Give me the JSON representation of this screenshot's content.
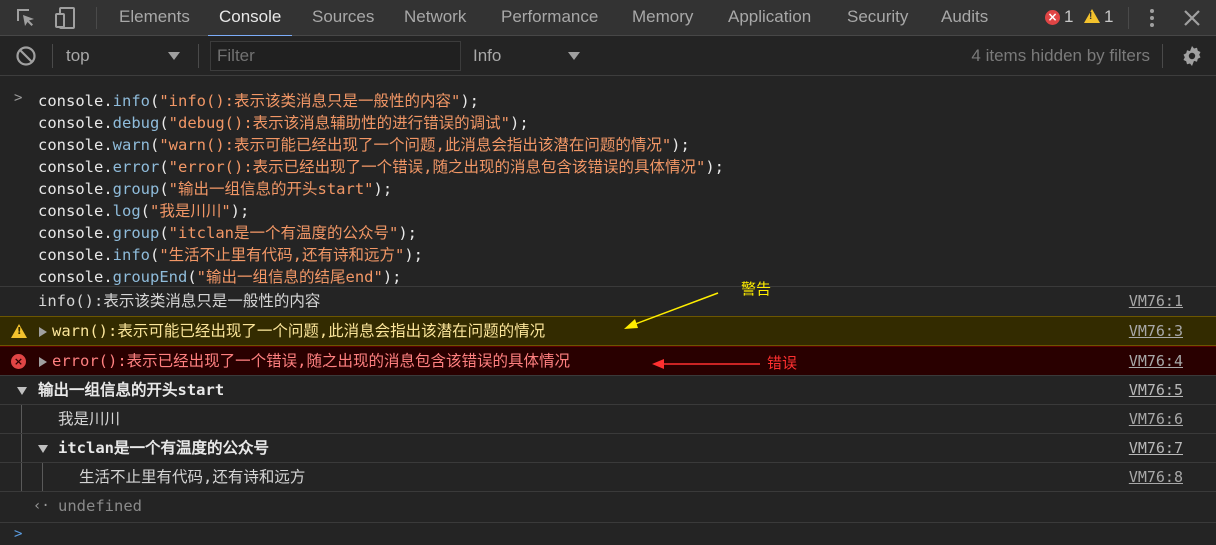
{
  "toolbar": {
    "tabs": [
      "Elements",
      "Console",
      "Sources",
      "Network",
      "Performance",
      "Memory",
      "Application",
      "Security",
      "Audits"
    ],
    "active_tab": "Console",
    "error_count": "1",
    "warning_count": "1"
  },
  "filter_bar": {
    "context": "top",
    "filter_placeholder": "Filter",
    "level": "Info",
    "hidden_text": "4 items hidden by filters"
  },
  "command_lines": [
    {
      "obj": "console.",
      "fn": "info",
      "arg": "\"info():表示该类消息只是一般性的内容\"",
      "end": ");"
    },
    {
      "obj": "console.",
      "fn": "debug",
      "arg": "\"debug():表示该消息辅助性的进行错误的调试\"",
      "end": ");"
    },
    {
      "obj": "console.",
      "fn": "warn",
      "arg": "\"warn():表示可能已经出现了一个问题,此消息会指出该潜在问题的情况\"",
      "end": ");"
    },
    {
      "obj": "console.",
      "fn": "error",
      "arg": "\"error():表示已经出现了一个错误,随之出现的消息包含该错误的具体情况\"",
      "end": ");"
    },
    {
      "obj": "console.",
      "fn": "group",
      "arg": "\"输出一组信息的开头start\"",
      "end": ");"
    },
    {
      "obj": "console.",
      "fn": "log",
      "arg": "\"我是川川\"",
      "end": ");"
    },
    {
      "obj": "console.",
      "fn": "group",
      "arg": "\"itclan是一个有温度的公众号\"",
      "end": ");"
    },
    {
      "obj": "console.",
      "fn": "info",
      "arg": "\"生活不止里有代码,还有诗和远方\"",
      "end": ");"
    },
    {
      "obj": "console.",
      "fn": "groupEnd",
      "arg": "\"输出一组信息的结尾end\"",
      "end": ");"
    }
  ],
  "messages": [
    {
      "text": "info():表示该类消息只是一般性的内容",
      "source": "VM76:1"
    },
    {
      "text": "warn():表示可能已经出现了一个问题,此消息会指出该潜在问题的情况",
      "source": "VM76:3"
    },
    {
      "text": "error():表示已经出现了一个错误,随之出现的消息包含该错误的具体情况",
      "source": "VM76:4"
    },
    {
      "text": "输出一组信息的开头start",
      "source": "VM76:5"
    },
    {
      "text": "我是川川",
      "source": "VM76:6"
    },
    {
      "text": "itclan是一个有温度的公众号",
      "source": "VM76:7"
    },
    {
      "text": "生活不止里有代码,还有诗和远方",
      "source": "VM76:8"
    }
  ],
  "return_value": "undefined",
  "annotations": {
    "warning_label": "警告",
    "error_label": "错误"
  },
  "colors": {
    "warning_annotation": "#ffee00",
    "error_annotation": "#ff3030",
    "active_tab_underline": "#7cacf8"
  }
}
